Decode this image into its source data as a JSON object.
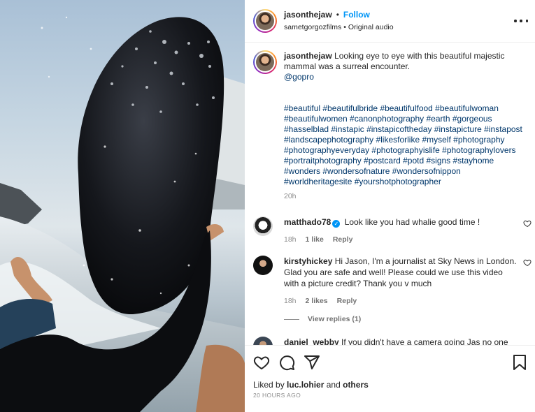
{
  "post": {
    "author": "jasonthejaw",
    "follow_label": "Follow",
    "separator": "•",
    "collaborator": "sametgorgozfilms",
    "audio": "Original audio",
    "media_description": "Humpback whale breaching beside a person in the water"
  },
  "caption": {
    "username": "jasonthejaw",
    "text": "Looking eye to eye with this beautiful majestic mammal was a surreal encounter.",
    "mention": "@gopro",
    "hashtags": "#beautiful #beautifulbride #beautifulfood #beautifulwoman #beautifulwomen #canonphotography #earth #gorgeous #hasselblad #instapic #instapicoftheday #instapicture #instapost #landscapephotography #likesforlike #myself #photography #photographyeveryday #photographyislife #photographylovers #portraitphotography #postcard #potd #signs #stayhome #wonders #wondersofnature #wondersofnippon #worldheritagesite #yourshotphotographer",
    "time": "20h"
  },
  "comments": [
    {
      "username": "matthado78",
      "verified": true,
      "text": "Look like you had whalie good time !",
      "time": "18h",
      "likes": "1 like",
      "reply": "Reply"
    },
    {
      "username": "kirstyhickey",
      "verified": false,
      "text": "Hi Jason, I'm a journalist at Sky News in London. Glad you are safe and well! Please could we use this video with a picture credit? Thank you v much",
      "time": "18h",
      "likes": "2 likes",
      "reply": "Reply",
      "view_replies": "View replies (1)"
    },
    {
      "username": "daniel_webby",
      "text": "If you didn't have a camera going Jas no one"
    }
  ],
  "footer": {
    "liked_by_prefix": "Liked by",
    "liked_by_user": "luc.lohier",
    "liked_by_and": "and",
    "liked_by_others": "others",
    "posted_ago": "20 HOURS AGO"
  },
  "icons": {
    "more": "more-options-icon",
    "like": "heart-icon",
    "comment": "comment-icon",
    "share": "share-icon",
    "save": "bookmark-icon",
    "verified": "verified-badge-icon"
  },
  "colors": {
    "link": "#00376b",
    "accent": "#0095f6",
    "muted": "#8e8e8e",
    "text": "#262626"
  }
}
